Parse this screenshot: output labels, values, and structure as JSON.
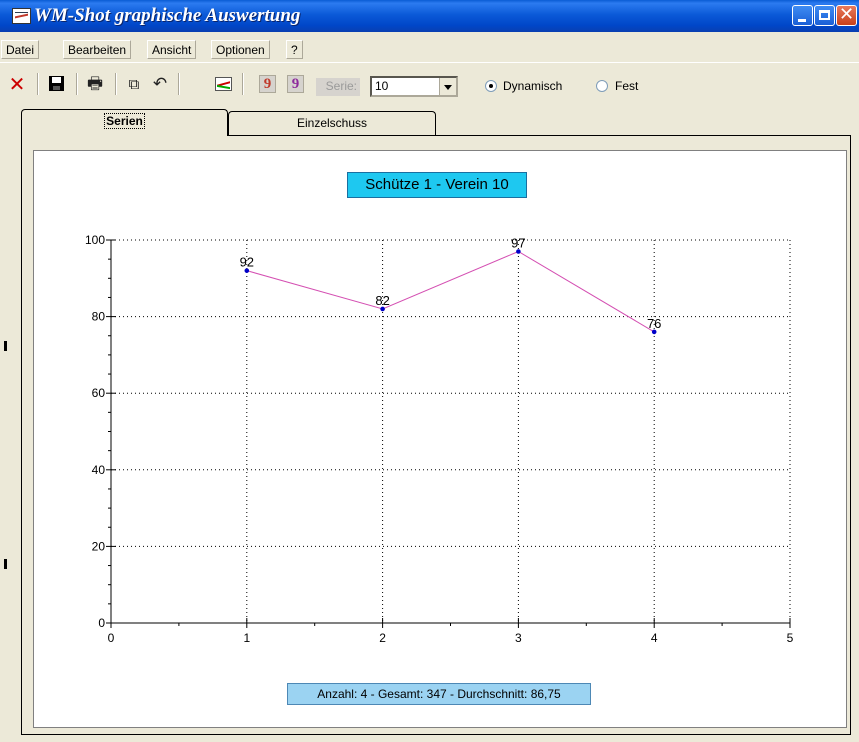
{
  "window": {
    "title": "WM-Shot graphische Auswertung"
  },
  "menu": [
    "Datei",
    "Bearbeiten",
    "Ansicht",
    "Optionen",
    "?"
  ],
  "toolbar": {
    "nine_1": "9",
    "nine_2": "9",
    "serie_label": "Serie:",
    "serie_value": "10",
    "radio_dynamic": "Dynamisch",
    "radio_fixed": "Fest",
    "selected_mode": "Dynamisch",
    "nine_1_color": "#c0392b",
    "nine_2_color": "#8e2a9c"
  },
  "tabs": {
    "active": "Serien",
    "inactive": "Einzelschuss"
  },
  "summary": "Anzahl: 4 - Gesamt: 347 - Durchschnitt: 86,75",
  "colors": {
    "line": "#d44fb2",
    "point": "#0000c8",
    "title_bg": "#1ec8f0",
    "summary_bg": "#9bd3f2"
  },
  "chart_data": {
    "type": "line",
    "title": "Schütze  1 - Verein 10",
    "x": [
      1,
      2,
      3,
      4
    ],
    "values": [
      92,
      82,
      97,
      76
    ],
    "data_labels": [
      "92",
      "82",
      "97",
      "76"
    ],
    "xlim": [
      0,
      5
    ],
    "ylim": [
      0,
      100
    ],
    "x_ticks": [
      "0",
      "1",
      "2",
      "3",
      "4",
      "5"
    ],
    "y_ticks": [
      "0",
      "20",
      "40",
      "60",
      "80",
      "100"
    ],
    "grid": true
  }
}
